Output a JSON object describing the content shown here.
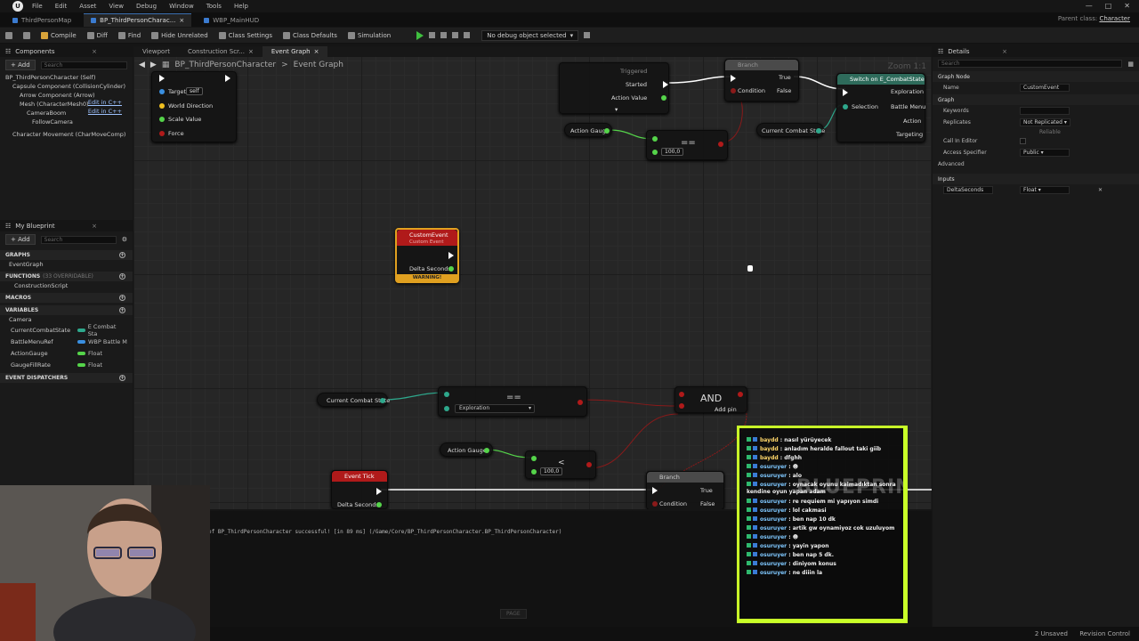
{
  "menu": {
    "items": [
      "File",
      "Edit",
      "Asset",
      "View",
      "Debug",
      "Window",
      "Tools",
      "Help"
    ],
    "logo": "U"
  },
  "tabs": [
    {
      "label": "ThirdPersonMap"
    },
    {
      "label": "BP_ThirdPersonCharac..."
    },
    {
      "label": "WBP_MainHUD"
    }
  ],
  "parent_class": {
    "label": "Parent class:",
    "value": "Character"
  },
  "toolbar": {
    "compile": "Compile",
    "diff": "Diff",
    "find": "Find",
    "hide_unrelated": "Hide Unrelated",
    "class_settings": "Class Settings",
    "class_defaults": "Class Defaults",
    "simulation": "Simulation",
    "debug_select": "No debug object selected"
  },
  "components": {
    "title": "Components",
    "add": "+ Add",
    "search_placeholder": "Search",
    "items": [
      {
        "label": "BP_ThirdPersonCharacter (Self)",
        "edit": ""
      },
      {
        "label": "Capsule Component (CollisionCylinder)",
        "edit": ""
      },
      {
        "label": "Arrow Component (Arrow)",
        "edit": "Edit in C++"
      },
      {
        "label": "Mesh (CharacterMesh0)",
        "edit": "Edit in C++"
      },
      {
        "label": "CameraBoom",
        "edit": ""
      },
      {
        "label": "FollowCamera",
        "edit": ""
      },
      {
        "label": "Character Movement (CharMoveComp)",
        "edit": ""
      }
    ]
  },
  "my_blueprint": {
    "title": "My Blueprint",
    "add": "+ Add",
    "search_placeholder": "Search",
    "graphs_label": "GRAPHS",
    "event_graph": "EventGraph",
    "functions_label": "FUNCTIONS",
    "functions_overridable": "(33 OVERRIDABLE)",
    "construction_script": "ConstructionScript",
    "macros_label": "MACROS",
    "variables_label": "VARIABLES",
    "camera_category": "Camera",
    "variables": [
      {
        "name": "CurrentCombatState",
        "type": "E Combat Sta",
        "color": "#2ea88c"
      },
      {
        "name": "BattleMenuRef",
        "type": "WBP Battle M",
        "color": "#3a8fe0"
      },
      {
        "name": "ActionGauge",
        "type": "Float",
        "color": "#55d44a"
      },
      {
        "name": "GaugeFillRate",
        "type": "Float",
        "color": "#55d44a"
      }
    ],
    "event_dispatchers_label": "EVENT DISPATCHERS"
  },
  "graph": {
    "tabs": [
      "Viewport",
      "Construction Scr...",
      "Event Graph"
    ],
    "breadcrumb_root": "BP_ThirdPersonCharacter",
    "breadcrumb_leaf": "Event Graph",
    "zoom": "Zoom 1:1",
    "nodes": {
      "add_movement": {
        "target": "Target",
        "self": "self",
        "world_direction": "World Direction",
        "scale_value": "Scale Value",
        "force": "Force"
      },
      "input_action": {
        "triggered": "Triggered",
        "started": "Started",
        "action_value": "Action Value"
      },
      "branch_top": {
        "title": "Branch",
        "condition": "Condition",
        "true": "True",
        "false": "False"
      },
      "switch": {
        "title": "Switch on E_CombatState",
        "exploration": "Exploration",
        "selection": "Selection",
        "battle_menu": "Battle Menu",
        "action": "Action",
        "targeting": "Targeting"
      },
      "action_gauge_top": "Action Gauge",
      "equal_top": "==",
      "value_top": "100,0",
      "current_combat_top": "Current Combat State",
      "custom_event": {
        "title": "CustomEvent",
        "subtitle": "Custom Event",
        "delta": "Delta Seconds",
        "warning": "WARNING!"
      },
      "current_combat_bottom": "Current Combat State",
      "equal_enum": "==",
      "enum_value": "Exploration",
      "and": {
        "title": "AND",
        "add_pin": "Add pin"
      },
      "action_gauge_bottom": "Action Gauge",
      "less": "<",
      "value_bottom": "100,0",
      "event_tick": {
        "title": "Event Tick",
        "delta": "Delta Seconds"
      },
      "branch_bottom": {
        "title": "Branch",
        "condition": "Condition",
        "true": "True",
        "false": "False"
      }
    }
  },
  "output_log": {
    "text": "of BP_ThirdPersonCharacter successful! [in 89 ms] (/Game/Core/BP_ThirdPersonCharacter.BP_ThirdPersonCharacter)",
    "page": "PAGE"
  },
  "details": {
    "title": "Details",
    "search_placeholder": "Search",
    "graph_node": "Graph Node",
    "name_label": "Name",
    "name_value": "CustomEvent",
    "graph": "Graph",
    "keywords": "Keywords",
    "replicates": "Replicates",
    "replicates_value": "Not Replicated",
    "reliable": "Reliable",
    "call_in_editor": "Call In Editor",
    "access_specifier": "Access Specifier",
    "access_value": "Public",
    "advanced": "Advanced",
    "inputs": "Inputs",
    "input_name": "DeltaSeconds",
    "input_type": "Float"
  },
  "chat": {
    "watermark": "BLUEPRINT",
    "messages": [
      {
        "user": "baydd",
        "text": "nasıl yürüyecek"
      },
      {
        "user": "baydd",
        "text": "anladım heralde fallout taki giib"
      },
      {
        "user": "baydd",
        "text": "dfghh"
      },
      {
        "user": "osuruyer",
        "text": ""
      },
      {
        "user": "osuruyer",
        "text": "alo"
      },
      {
        "user": "osuruyer",
        "text": "oynacak oyunu kalmadıktan sonra kendine oyun yapan adam"
      },
      {
        "user": "osuruyer",
        "text": "re requiem mi yapıyon simdi"
      },
      {
        "user": "osuruyer",
        "text": "lol cakmasi"
      },
      {
        "user": "osuruyer",
        "text": "ben nap 10 dk"
      },
      {
        "user": "osuruyer",
        "text": "artik gw oynamiyoz cok uzuluyom"
      },
      {
        "user": "osuruyer",
        "text": ""
      },
      {
        "user": "osuruyer",
        "text": "yayin yapon"
      },
      {
        "user": "osuruyer",
        "text": "ben nap 5 dk."
      },
      {
        "user": "osuruyer",
        "text": "diniyom konus"
      },
      {
        "user": "osuruyer",
        "text": "ne diiin la"
      }
    ]
  },
  "status": {
    "unsaved": "2 Unsaved",
    "revision": "Revision Control"
  },
  "colors": {
    "accent": "#c8ff28",
    "exec": "#ffffff",
    "float_pin": "#55d44a",
    "enum_pin": "#2ea88c",
    "event_red": "#b01a1a",
    "warning": "#e0a020"
  }
}
